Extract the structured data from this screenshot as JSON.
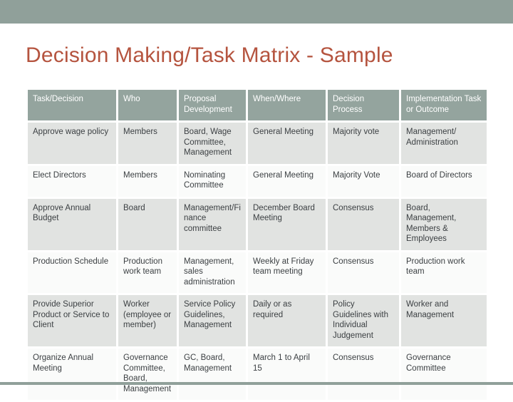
{
  "slide": {
    "title": "Decision Making/Task Matrix - Sample",
    "accent_title_color": "#b5543f",
    "band_color": "#90a09a",
    "header_row_color": "#94a49e",
    "row_color": "#e1e3e1",
    "alt_row_color": "#fafbfa"
  },
  "table": {
    "columns": [
      "Task/Decision",
      "Who",
      "Proposal Development",
      "When/Where",
      "Decision Process",
      "Implementation Task or Outcome"
    ],
    "rows": [
      {
        "task": "Approve wage policy",
        "who": "Members",
        "proposal": "Board, Wage Committee, Management",
        "when": "General Meeting",
        "process": "Majority vote",
        "implementation": "Management/ Administration"
      },
      {
        "task": "Elect Directors",
        "who": "Members",
        "proposal": "Nominating Committee",
        "when": "General Meeting",
        "process": "Majority Vote",
        "implementation": "Board of Directors"
      },
      {
        "task": "Approve Annual Budget",
        "who": "Board",
        "proposal": "Management/Fi nance committee",
        "when": "December Board Meeting",
        "process": "Consensus",
        "implementation": "Board, Management, Members & Employees"
      },
      {
        "task": "Production Schedule",
        "who": "Production work team",
        "proposal": "Management, sales administration",
        "when": "Weekly at Friday team meeting",
        "process": "Consensus",
        "implementation": "Production work team"
      },
      {
        "task": "Provide Superior Product or Service to Client",
        "who": "Worker (employee or member)",
        "proposal": "Service Policy Guidelines, Management",
        "when": "Daily or as required",
        "process": "Policy Guidelines with Individual Judgement",
        "implementation": "Worker and Management"
      },
      {
        "task": "Organize Annual Meeting",
        "who": "Governance Committee, Board, Management",
        "proposal": "GC, Board, Management",
        "when": "March 1 to April 15",
        "process": "Consensus",
        "implementation": "Governance Committee"
      }
    ]
  }
}
